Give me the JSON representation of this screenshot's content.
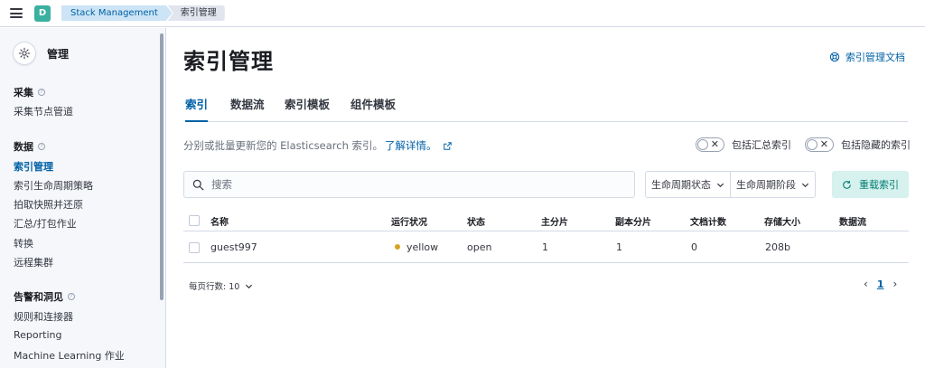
{
  "header": {
    "avatar_letter": "D",
    "breadcrumbs": [
      "Stack Management",
      "索引管理"
    ]
  },
  "sidebar": {
    "title": "管理",
    "groups": [
      {
        "label": "采集",
        "items": [
          "采集节点管道"
        ]
      },
      {
        "label": "数据",
        "items": [
          "索引管理",
          "索引生命周期策略",
          "拍取快照并还原",
          "汇总/打包作业",
          "转换",
          "远程集群"
        ]
      },
      {
        "label": "告警和洞见",
        "items": [
          "规则和连接器",
          "Reporting",
          "Machine Learning 作业"
        ]
      }
    ],
    "active_item": "索引管理"
  },
  "main": {
    "title": "索引管理",
    "doc_link": "索引管理文档",
    "tabs": [
      "索引",
      "数据流",
      "索引模板",
      "组件模板"
    ],
    "active_tab": "索引",
    "description": "分别或批量更新您的 Elasticsearch 索引。",
    "learn_more": "了解详情。",
    "toggle_rollup": "包括汇总索引",
    "toggle_hidden": "包括隐藏的索引",
    "search_placeholder": "搜索",
    "filter_lifecycle_status": "生命周期状态",
    "filter_lifecycle_phase": "生命周期阶段",
    "reload_button": "重载索引",
    "columns": [
      "名称",
      "运行状况",
      "状态",
      "主分片",
      "副本分片",
      "文档计数",
      "存储大小",
      "数据流"
    ],
    "rows": [
      {
        "name": "guest997",
        "health": "yellow",
        "status": "open",
        "primary": "1",
        "replica": "1",
        "docs": "0",
        "size": "208b",
        "data_stream": ""
      }
    ],
    "rows_per_page": "每页行数: 10",
    "current_page": "1"
  },
  "colors": {
    "accent": "#0061a6",
    "health_yellow": "#d6a422",
    "reload_bg": "#d6f1ee",
    "reload_text": "#017d73"
  }
}
